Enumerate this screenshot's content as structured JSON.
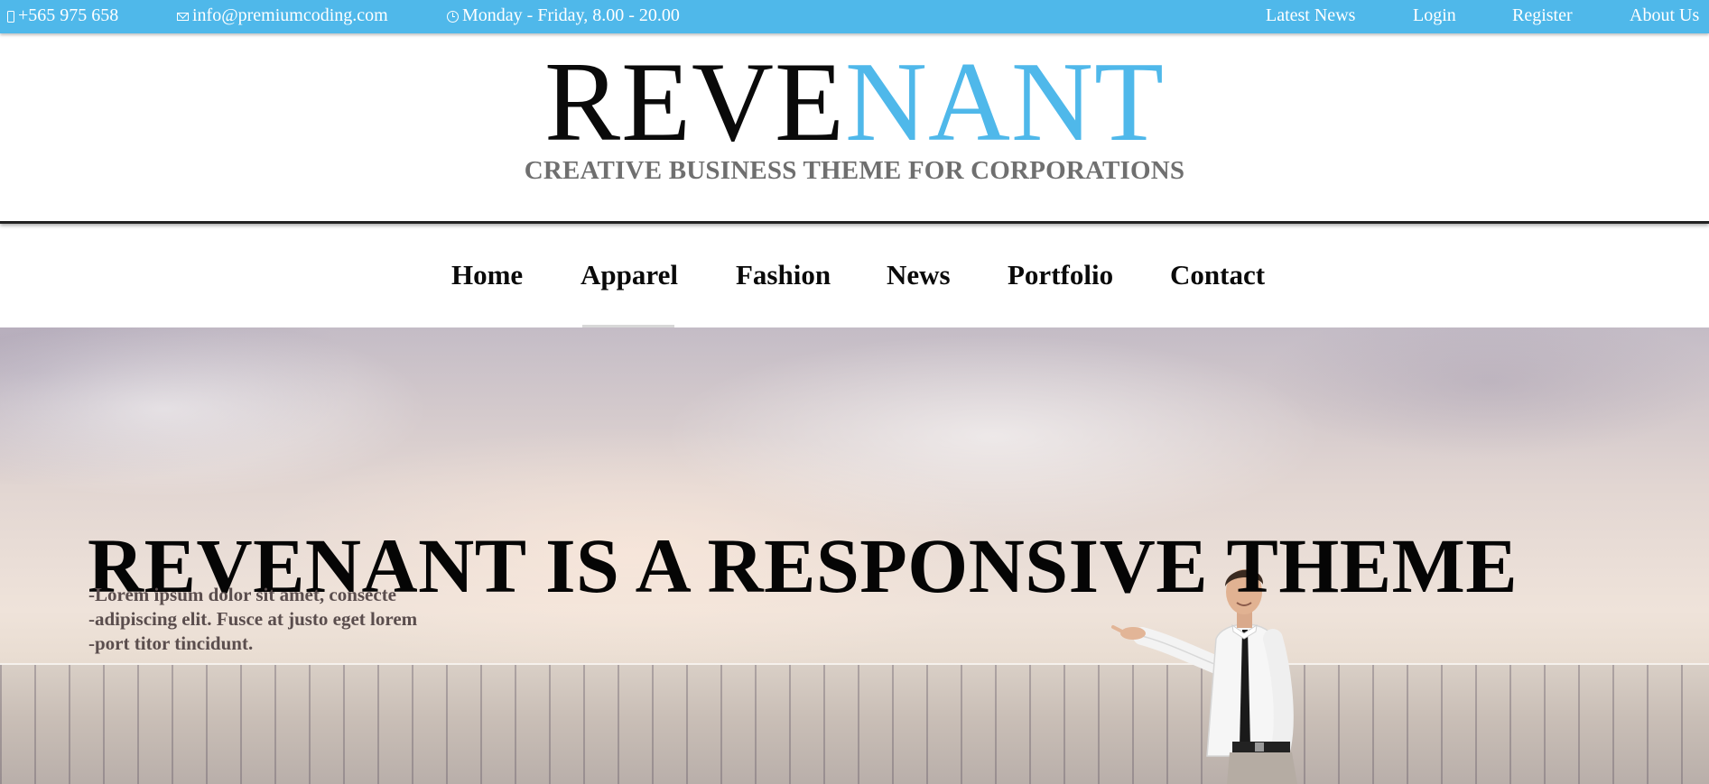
{
  "topbar": {
    "phone": "+565 975 658",
    "email": "info@premiumcoding.com",
    "hours": "Monday - Friday, 8.00 - 20.00",
    "links": [
      "Latest News",
      "Login",
      "Register",
      "About Us"
    ]
  },
  "logo": {
    "part1": "REVE",
    "part2": "NANT",
    "tagline": "CREATIVE BUSINESS THEME FOR CORPORATIONS"
  },
  "nav": {
    "items": [
      "Home",
      "Apparel",
      "Fashion",
      "News",
      "Portfolio",
      "Contact"
    ],
    "active": "Apparel"
  },
  "hero": {
    "title": "REVENANT IS A RESPONSIVE THEME",
    "lines": [
      "-Lorem ipsum dolor sit amet, consecte",
      "-adipiscing elit. Fusce at justo eget lorem",
      "-port titor tincidunt."
    ]
  },
  "colors": {
    "accent": "#4fb8ea",
    "text_dark": "#0a0a0a",
    "tagline": "#6f6f6f"
  },
  "icons": [
    "phone-icon",
    "mail-icon",
    "clock-icon"
  ]
}
